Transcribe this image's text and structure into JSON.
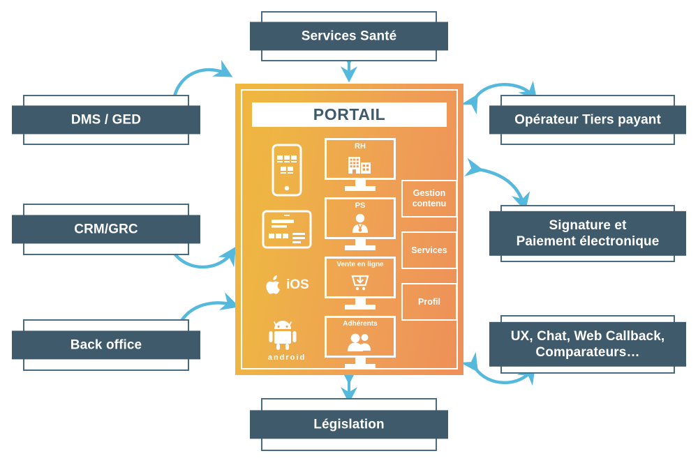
{
  "diagram": {
    "title": "PORTAIL",
    "center": {
      "title": "PORTAIL",
      "devices": [
        {
          "name": "smartphone-icon",
          "label": ""
        },
        {
          "name": "tablet-icon",
          "label": ""
        },
        {
          "name": "apple-ios-icon",
          "label": "iOS"
        },
        {
          "name": "android-icon",
          "label": "android"
        }
      ],
      "screens": [
        {
          "label": "RH",
          "icon": "building-icon"
        },
        {
          "label": "PS",
          "icon": "doctor-icon"
        },
        {
          "label": "Vente en ligne",
          "icon": "shopping-cart-icon"
        },
        {
          "label": "Adhérents",
          "icon": "people-icon"
        }
      ],
      "tiles": [
        {
          "label": "Gestion contenu"
        },
        {
          "label": "Services"
        },
        {
          "label": "Profil"
        }
      ]
    },
    "external": {
      "top": {
        "label": "Services Santé"
      },
      "bottom": {
        "label": "Législation"
      },
      "left": [
        {
          "label": "DMS / GED"
        },
        {
          "label": "CRM/GRC"
        },
        {
          "label": "Back office"
        }
      ],
      "right": [
        {
          "label": "Opérateur Tiers payant"
        },
        {
          "label": "Signature et\nPaiement électronique"
        },
        {
          "label": "UX, Chat, Web Callback,\nComparateurs…"
        }
      ]
    },
    "colors": {
      "box_bar": "#3e5a6b",
      "box_outline": "#4a6a80",
      "arrow": "#55b9dd",
      "portal_gradient_start": "#f0b73f",
      "portal_gradient_end": "#ee8f59",
      "text_on_white": "#3e5a6b"
    }
  }
}
